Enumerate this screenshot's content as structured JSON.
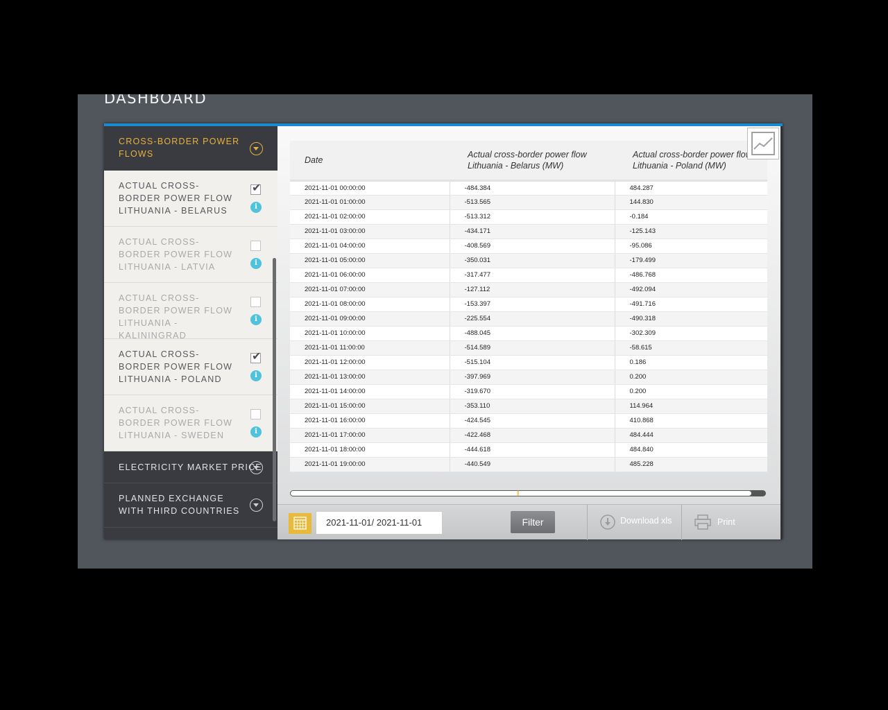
{
  "page": {
    "title": "DASHBOARD"
  },
  "sidebar": {
    "section_title": "CROSS-BORDER POWER FLOWS",
    "items": [
      {
        "label": "ACTUAL CROSS-BORDER POWER FLOW LITHUANIA - BELARUS",
        "checked": true,
        "info": "i"
      },
      {
        "label": "ACTUAL CROSS-BORDER POWER FLOW LITHUANIA - LATVIA",
        "checked": false,
        "info": "i"
      },
      {
        "label": "ACTUAL CROSS-BORDER POWER FLOW LITHUANIA - KALININGRAD",
        "checked": false,
        "info": "i"
      },
      {
        "label": "ACTUAL CROSS-BORDER POWER FLOW LITHUANIA - POLAND",
        "checked": true,
        "info": "i"
      },
      {
        "label": "ACTUAL CROSS-BORDER POWER FLOW LITHUANIA - SWEDEN",
        "checked": false,
        "info": "i"
      }
    ],
    "sections": [
      {
        "label": "ELECTRICITY MARKET PRICE"
      },
      {
        "label": "PLANNED EXCHANGE WITH THIRD COUNTRIES"
      }
    ]
  },
  "table": {
    "headers": [
      "Date",
      "Actual cross-border power flow Lithuania - Belarus (MW)",
      "Actual cross-border power flow Lithuania - Poland (MW)"
    ],
    "rows": [
      [
        "2021-11-01 00:00:00",
        "-484.384",
        "484.287"
      ],
      [
        "2021-11-01 01:00:00",
        "-513.565",
        "144.830"
      ],
      [
        "2021-11-01 02:00:00",
        "-513.312",
        "-0.184"
      ],
      [
        "2021-11-01 03:00:00",
        "-434.171",
        "-125.143"
      ],
      [
        "2021-11-01 04:00:00",
        "-408.569",
        "-95.086"
      ],
      [
        "2021-11-01 05:00:00",
        "-350.031",
        "-179.499"
      ],
      [
        "2021-11-01 06:00:00",
        "-317.477",
        "-486.768"
      ],
      [
        "2021-11-01 07:00:00",
        "-127.112",
        "-492.094"
      ],
      [
        "2021-11-01 08:00:00",
        "-153.397",
        "-491.716"
      ],
      [
        "2021-11-01 09:00:00",
        "-225.554",
        "-490.318"
      ],
      [
        "2021-11-01 10:00:00",
        "-488.045",
        "-302.309"
      ],
      [
        "2021-11-01 11:00:00",
        "-514.589",
        "-58.615"
      ],
      [
        "2021-11-01 12:00:00",
        "-515.104",
        "0.186"
      ],
      [
        "2021-11-01 13:00:00",
        "-397.969",
        "0.200"
      ],
      [
        "2021-11-01 14:00:00",
        "-319.670",
        "0.200"
      ],
      [
        "2021-11-01 15:00:00",
        "-353.110",
        "114.964"
      ],
      [
        "2021-11-01 16:00:00",
        "-424.545",
        "410.868"
      ],
      [
        "2021-11-01 17:00:00",
        "-422.468",
        "484.444"
      ],
      [
        "2021-11-01 18:00:00",
        "-444.618",
        "484.840"
      ],
      [
        "2021-11-01 19:00:00",
        "-440.549",
        "485.228"
      ]
    ]
  },
  "footer": {
    "date_range": "2021-11-01/ 2021-11-01",
    "filter_label": "Filter",
    "download_label": "Download xls",
    "print_label": "Print"
  },
  "colors": {
    "accent": "#e8b23a",
    "top_bar": "#1a8bd0",
    "info": "#4fc2dc",
    "sidebar_dark": "#393b41"
  },
  "icons": [
    "chart-line-icon",
    "calendar-icon",
    "download-icon",
    "printer-icon",
    "chevron-down-icon",
    "info-icon",
    "checkbox-icon"
  ]
}
